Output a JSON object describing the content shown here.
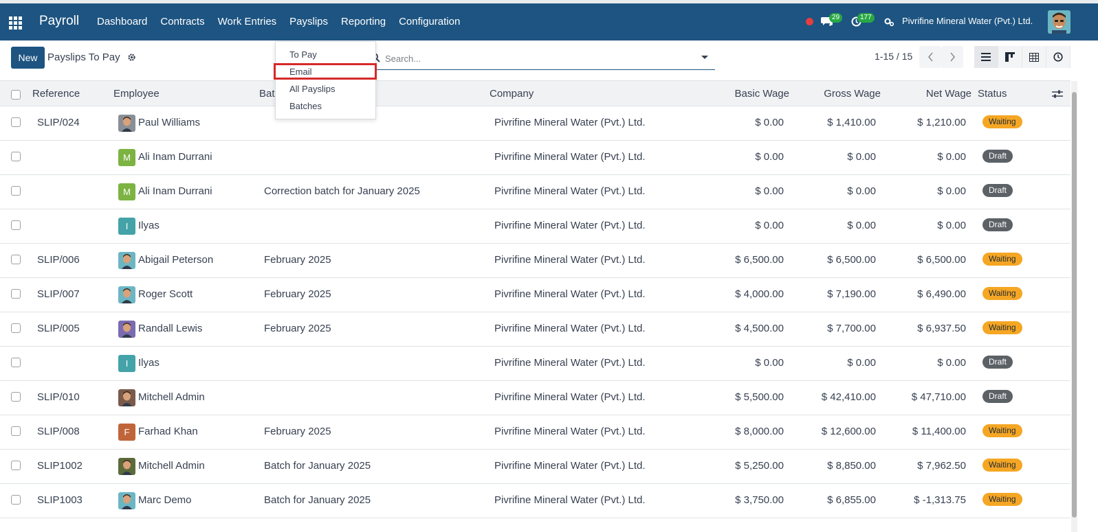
{
  "navbar": {
    "app_name": "Payroll",
    "menu": [
      "Dashboard",
      "Contracts",
      "Work Entries",
      "Payslips",
      "Reporting",
      "Configuration"
    ],
    "messages_count": "29",
    "activities_count": "177",
    "company": "Pivrifine Mineral Water (Pvt.) Ltd.",
    "accent_color": "#1d5481"
  },
  "control_panel": {
    "new_label": "New",
    "breadcrumb": "Payslips To Pay",
    "search_placeholder": "Search...",
    "pager": "1-15 / 15"
  },
  "dropdown": {
    "items": [
      "To Pay",
      "Email",
      "All Payslips",
      "Batches"
    ],
    "highlighted": "Email"
  },
  "table": {
    "headers": {
      "reference": "Reference",
      "employee": "Employee",
      "batch": "Bat",
      "company": "Company",
      "basic_wage": "Basic Wage",
      "gross_wage": "Gross Wage",
      "net_wage": "Net Wage",
      "status": "Status"
    },
    "rows": [
      {
        "reference": "SLIP/024",
        "employee": "Paul Williams",
        "avatar": "photo",
        "batch": "",
        "company": "Pivrifine Mineral Water (Pvt.) Ltd.",
        "basic": "$ 0.00",
        "gross": "$ 1,410.00",
        "net": "$ 1,210.00",
        "status": "Waiting"
      },
      {
        "reference": "",
        "employee": "Ali Inam Durrani",
        "avatar": "M",
        "batch": "",
        "company": "Pivrifine Mineral Water (Pvt.) Ltd.",
        "basic": "$ 0.00",
        "gross": "$ 0.00",
        "net": "$ 0.00",
        "status": "Draft"
      },
      {
        "reference": "",
        "employee": "Ali Inam Durrani",
        "avatar": "M",
        "batch": "Correction batch for January 2025",
        "company": "Pivrifine Mineral Water (Pvt.) Ltd.",
        "basic": "$ 0.00",
        "gross": "$ 0.00",
        "net": "$ 0.00",
        "status": "Draft"
      },
      {
        "reference": "",
        "employee": "Ilyas",
        "avatar": "I",
        "batch": "",
        "company": "Pivrifine Mineral Water (Pvt.) Ltd.",
        "basic": "$ 0.00",
        "gross": "$ 0.00",
        "net": "$ 0.00",
        "status": "Draft"
      },
      {
        "reference": "SLIP/006",
        "employee": "Abigail Peterson",
        "avatar": "photo",
        "batch": "February 2025",
        "company": "Pivrifine Mineral Water (Pvt.) Ltd.",
        "basic": "$ 6,500.00",
        "gross": "$ 6,500.00",
        "net": "$ 6,500.00",
        "status": "Waiting"
      },
      {
        "reference": "SLIP/007",
        "employee": "Roger Scott",
        "avatar": "photo",
        "batch": "February 2025",
        "company": "Pivrifine Mineral Water (Pvt.) Ltd.",
        "basic": "$ 4,000.00",
        "gross": "$ 7,190.00",
        "net": "$ 6,490.00",
        "status": "Waiting"
      },
      {
        "reference": "SLIP/005",
        "employee": "Randall Lewis",
        "avatar": "photo",
        "batch": "February 2025",
        "company": "Pivrifine Mineral Water (Pvt.) Ltd.",
        "basic": "$ 4,500.00",
        "gross": "$ 7,700.00",
        "net": "$ 6,937.50",
        "status": "Waiting"
      },
      {
        "reference": "",
        "employee": "Ilyas",
        "avatar": "I",
        "batch": "",
        "company": "Pivrifine Mineral Water (Pvt.) Ltd.",
        "basic": "$ 0.00",
        "gross": "$ 0.00",
        "net": "$ 0.00",
        "status": "Draft"
      },
      {
        "reference": "SLIP/010",
        "employee": "Mitchell Admin",
        "avatar": "photo",
        "batch": "",
        "company": "Pivrifine Mineral Water (Pvt.) Ltd.",
        "basic": "$ 5,500.00",
        "gross": "$ 42,410.00",
        "net": "$ 47,710.00",
        "status": "Draft"
      },
      {
        "reference": "SLIP/008",
        "employee": "Farhad Khan",
        "avatar": "F",
        "batch": "February 2025",
        "company": "Pivrifine Mineral Water (Pvt.) Ltd.",
        "basic": "$ 8,000.00",
        "gross": "$ 12,600.00",
        "net": "$ 11,400.00",
        "status": "Waiting"
      },
      {
        "reference": "SLIP1002",
        "employee": "Mitchell Admin",
        "avatar": "photo",
        "batch": "Batch for January 2025",
        "company": "Pivrifine Mineral Water (Pvt.) Ltd.",
        "basic": "$ 5,250.00",
        "gross": "$ 8,850.00",
        "net": "$ 7,962.50",
        "status": "Waiting"
      },
      {
        "reference": "SLIP1003",
        "employee": "Marc Demo",
        "avatar": "photo",
        "batch": "Batch for January 2025",
        "company": "Pivrifine Mineral Water (Pvt.) Ltd.",
        "basic": "$ 3,750.00",
        "gross": "$ 6,855.00",
        "net": "$ -1,313.75",
        "status": "Waiting"
      }
    ]
  },
  "colors": {
    "waiting": "#f5a623",
    "draft": "#5c6166",
    "highlight_box": "#d62828"
  }
}
